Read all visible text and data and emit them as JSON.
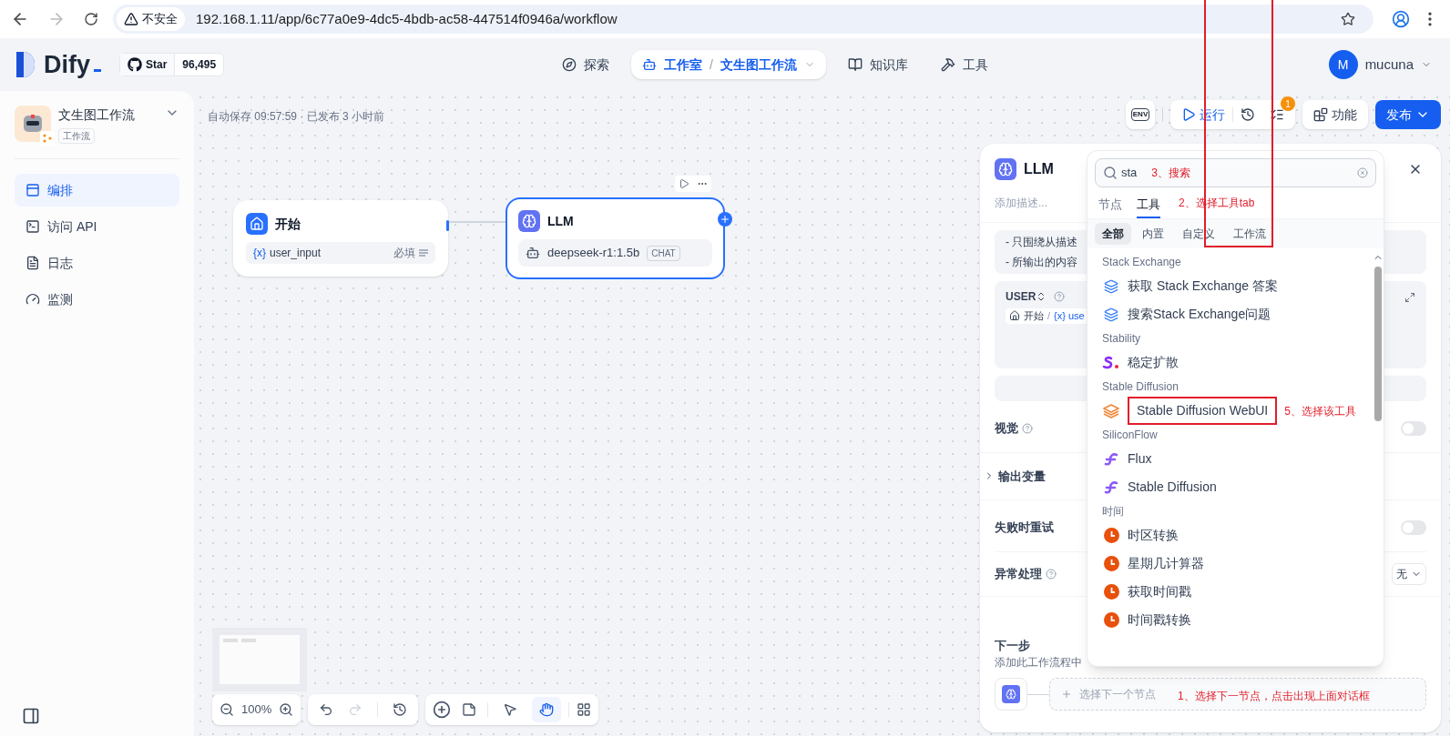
{
  "browser": {
    "security": "不安全",
    "url": "192.168.1.11/app/6c77a0e9-4dc5-4bdb-ac58-447514f0946a/workflow"
  },
  "header": {
    "logo": "Dify",
    "star_label": "Star",
    "star_count": "96,495",
    "nav": [
      {
        "label": "探索",
        "kind": "explore",
        "selected": false
      },
      {
        "label": "工作室",
        "kind": "studio",
        "selected": true,
        "separator": "/",
        "sub": "文生图工作流"
      },
      {
        "label": "知识库",
        "kind": "knowledge",
        "selected": false
      },
      {
        "label": "工具",
        "kind": "tools",
        "selected": false
      }
    ],
    "user": {
      "initial": "M",
      "name": "mucuna"
    }
  },
  "sidebar": {
    "app_name": "文生图工作流",
    "app_type": "工作流",
    "items": [
      {
        "label": "编排",
        "kind": "orchestrate",
        "selected": true
      },
      {
        "label": "访问 API",
        "kind": "api",
        "selected": false
      },
      {
        "label": "日志",
        "kind": "logs",
        "selected": false
      },
      {
        "label": "监测",
        "kind": "monitor",
        "selected": false
      }
    ]
  },
  "canvas": {
    "status": "自动保存 09:57:59 · 已发布 3 小时前",
    "toolbar": {
      "env": "ENV",
      "run": "运行",
      "badge": "1",
      "features": "功能",
      "publish": "发布"
    },
    "nodes": [
      {
        "kind": "start",
        "title": "开始",
        "var_icon": "{x}",
        "var": "user_input",
        "required": "必填",
        "selected": false
      },
      {
        "kind": "llm",
        "title": "LLM",
        "model": "deepseek-r1:1.5b",
        "mode": "CHAT",
        "selected": true
      }
    ],
    "zoom": "100%",
    "tools": [
      {
        "kind": "pointer",
        "selected": false
      },
      {
        "kind": "hand",
        "selected": true
      }
    ]
  },
  "panel": {
    "title": "LLM",
    "description_placeholder": "添加描述...",
    "prompt_lines": [
      "- 只围绕从描述",
      "- 所输出的内容"
    ],
    "user_label": "USER",
    "var_source": "开始",
    "var_separator": "/",
    "var_icon": "{x}",
    "var_name": "use",
    "vision": {
      "label": "视觉",
      "on": false
    },
    "output_label": "输出变量",
    "retry": {
      "label": "失败时重试",
      "on": false
    },
    "error": {
      "label": "异常处理",
      "value": "无"
    },
    "next": {
      "title": "下一步",
      "description": "添加此工作流程中",
      "placeholder": "选择下一个节点"
    }
  },
  "popover": {
    "search": {
      "value": "sta"
    },
    "tabs": [
      {
        "label": "节点",
        "selected": false
      },
      {
        "label": "工具",
        "selected": true
      }
    ],
    "filters": [
      {
        "label": "全部",
        "selected": true
      },
      {
        "label": "内置",
        "selected": false
      },
      {
        "label": "自定义",
        "selected": false
      },
      {
        "label": "工作流",
        "selected": false
      }
    ],
    "groups": [
      {
        "name": "Stack Exchange",
        "items": [
          {
            "label": "获取 Stack Exchange 答案",
            "kind": "stack"
          },
          {
            "label": "搜索Stack Exchange问题",
            "kind": "stack"
          }
        ]
      },
      {
        "name": "Stability",
        "items": [
          {
            "label": "稳定扩散",
            "kind": "stability"
          }
        ]
      },
      {
        "name": "Stable Diffusion",
        "items": [
          {
            "label": "Stable Diffusion WebUI",
            "kind": "sdwebui"
          }
        ]
      },
      {
        "name": "SiliconFlow",
        "items": [
          {
            "label": "Flux",
            "kind": "siliconflow"
          },
          {
            "label": "Stable Diffusion",
            "kind": "siliconflow"
          }
        ]
      },
      {
        "name": "时间",
        "items": [
          {
            "label": "时区转换",
            "kind": "clock"
          },
          {
            "label": "星期几计算器",
            "kind": "clock"
          },
          {
            "label": "获取时间戳",
            "kind": "clock"
          },
          {
            "label": "时间戳转换",
            "kind": "clock"
          }
        ]
      }
    ]
  },
  "annotations": {
    "search": "3、搜索",
    "tab": "2、选择工具tab",
    "tool": "5、选择该工具",
    "next": "1、选择下一节点，点击出现上面对话框"
  }
}
